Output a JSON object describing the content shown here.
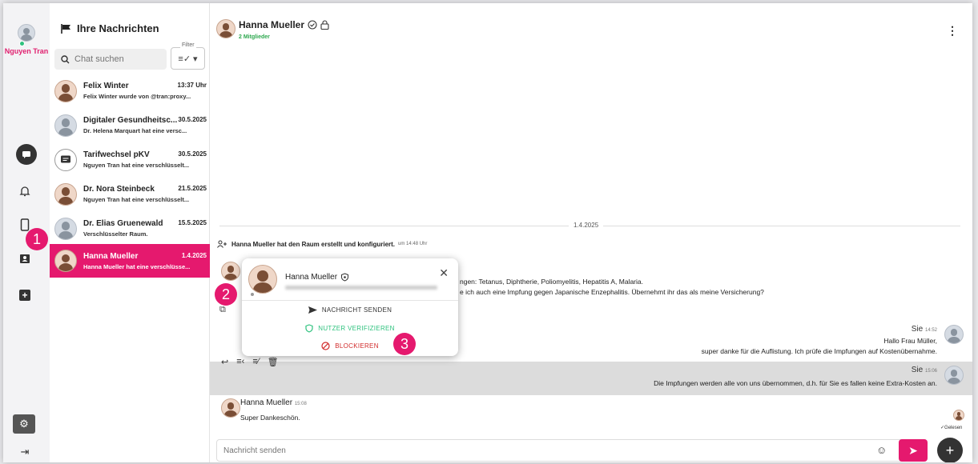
{
  "rail": {
    "user_name": "Nguyen Tran"
  },
  "list": {
    "title": "Ihre Nachrichten",
    "search_placeholder": "Chat suchen",
    "filter_label": "Filter",
    "chats": [
      {
        "name": "Felix Winter",
        "time": "13:37 Uhr",
        "preview": "Felix Winter wurde von @tran:proxy..."
      },
      {
        "name": "Digitaler Gesundheitsc...",
        "time": "30.5.2025",
        "preview": "Dr. Helena Marquart hat eine versc..."
      },
      {
        "name": "Tarifwechsel pKV",
        "time": "30.5.2025",
        "preview": "Nguyen Tran hat eine verschlüsselt..."
      },
      {
        "name": "Dr. Nora Steinbeck",
        "time": "21.5.2025",
        "preview": "Nguyen Tran hat eine verschlüsselt..."
      },
      {
        "name": "Dr. Elias Gruenewald",
        "time": "15.5.2025",
        "preview": "Verschlüsselter Raum."
      },
      {
        "name": "Hanna Mueller",
        "time": "1.4.2025",
        "preview": "Hanna Mueller hat eine verschlüsse..."
      }
    ]
  },
  "header": {
    "name": "Hanna Mueller",
    "members": "2 Mitglieder"
  },
  "timeline": {
    "date": "1.4.2025",
    "system": "Hanna Mueller hat den Raum erstellt und konfiguriert.",
    "system_time": "um 14:48 Uhr",
    "msg_line1": "ngen: Tetanus, Diphtherie, Poliomyelitis, Hepatitis A, Malaria.",
    "msg_line2": "e ich auch eine Impfung gegen Japanische Enzephalitis. Übernehmt ihr das als meine Versicherung?",
    "you1": {
      "sender": "Sie",
      "time": "14:52",
      "line1": "Hallo Frau Müller,",
      "line2": "super danke für die Auflistung. Ich prüfe die Impfungen auf Kostenübernahme."
    },
    "you2": {
      "sender": "Sie",
      "time": "15:06",
      "text": "Die Impfungen werden alle von uns übernommen, d.h. für Sie es fallen keine Extra-Kosten an."
    },
    "reply": {
      "sender": "Hanna Mueller",
      "time": "15:08",
      "text": "Super Dankeschön."
    },
    "read_label": "Gelesen"
  },
  "composer": {
    "placeholder": "Nachricht senden"
  },
  "popup": {
    "name": "Hanna Mueller",
    "send_message": "NACHRICHT SENDEN",
    "verify": "NUTZER VERIFIZIEREN",
    "block": "BLOCKIEREN"
  },
  "badges": [
    "1",
    "2",
    "3"
  ],
  "colors": {
    "accent": "#e5196e",
    "verify": "#2ec27e",
    "block": "#d12b2b"
  }
}
